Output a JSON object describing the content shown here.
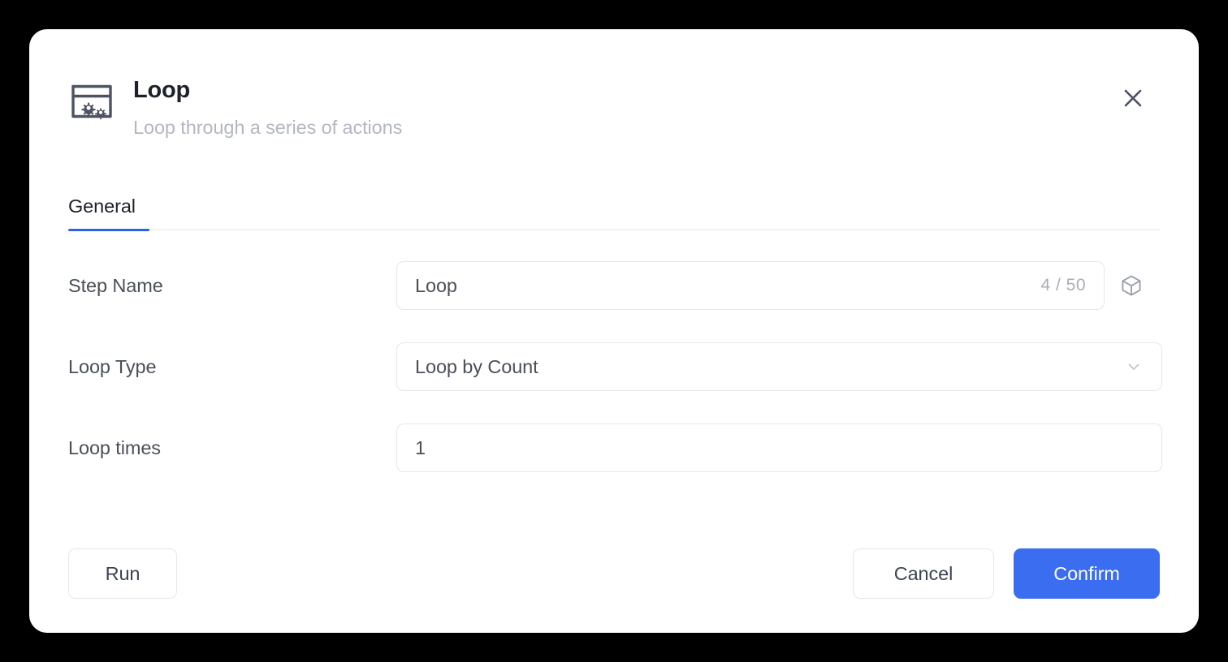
{
  "dialog": {
    "title": "Loop",
    "subtitle": "Loop through a series of actions",
    "icon": "window-gears-icon",
    "close_icon": "close-icon",
    "accent_color": "#3a6df0",
    "tab_underline_color": "#2b62e8",
    "background_color": "#000000",
    "surface_color": "#ffffff"
  },
  "tabs": [
    {
      "label": "General",
      "active": true
    }
  ],
  "form": {
    "step_name": {
      "label": "Step Name",
      "value": "Loop",
      "placeholder": "Step Name",
      "counter": "4 / 50",
      "current_length": 4,
      "max_length": 50,
      "variable_icon": "cube-icon"
    },
    "loop_type": {
      "label": "Loop Type",
      "value": "Loop by Count",
      "chevron_icon": "chevron-down-icon"
    },
    "loop_times": {
      "label": "Loop times",
      "value": "1",
      "placeholder": "Loop times"
    }
  },
  "footer": {
    "run_label": "Run",
    "cancel_label": "Cancel",
    "confirm_label": "Confirm"
  }
}
